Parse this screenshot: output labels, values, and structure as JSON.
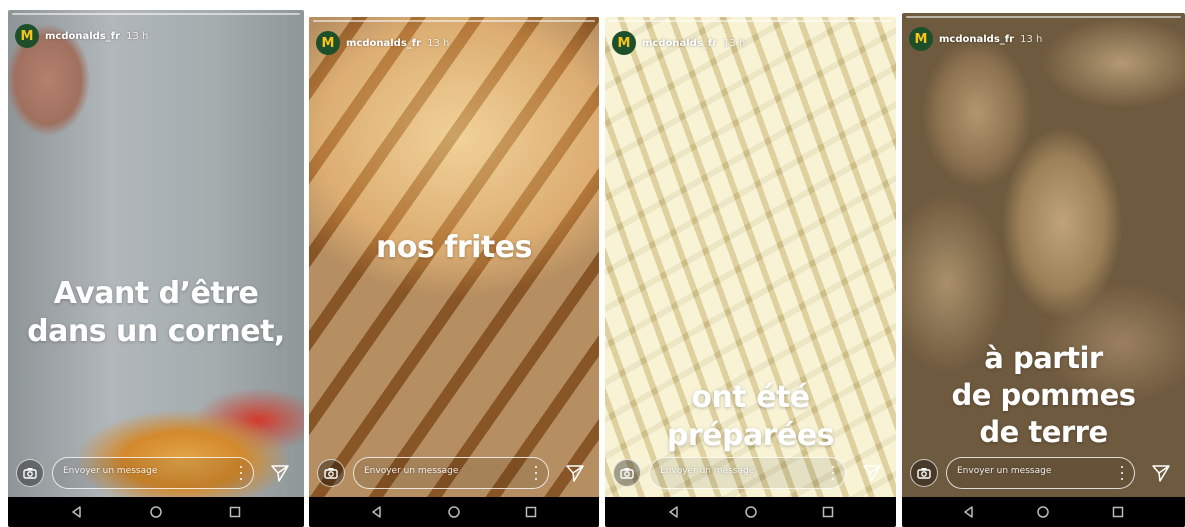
{
  "stories": [
    {
      "username": "mcdonalds_fr",
      "time": "13 h",
      "avatar_letter": "M",
      "caption_lines": [
        "Avant d’être",
        "dans un cornet,"
      ],
      "reply_placeholder": "Envoyer un message"
    },
    {
      "username": "mcdonalds_fr",
      "time": "13 h",
      "avatar_letter": "M",
      "caption_lines": [
        "nos frites"
      ],
      "reply_placeholder": "Envoyer un message"
    },
    {
      "username": "mcdonalds_fr",
      "time": "13 h",
      "avatar_letter": "M",
      "caption_lines": [
        "ont été",
        "préparées"
      ],
      "reply_placeholder": "Envoyer un message"
    },
    {
      "username": "mcdonalds_fr",
      "time": "13 h",
      "avatar_letter": "M",
      "caption_lines": [
        "à partir",
        "de pommes",
        "de terre"
      ],
      "reply_placeholder": "Envoyer un message"
    }
  ],
  "icons": {
    "camera": "camera-icon",
    "more": "more-vertical-icon",
    "send": "send-icon",
    "back": "back-triangle-icon",
    "home": "home-circle-icon",
    "recents": "recents-square-icon"
  },
  "colors": {
    "avatar_bg": "#1e4f2b",
    "avatar_letter": "#f5c518",
    "navbar": "#000000",
    "caption": "#ffffff"
  }
}
